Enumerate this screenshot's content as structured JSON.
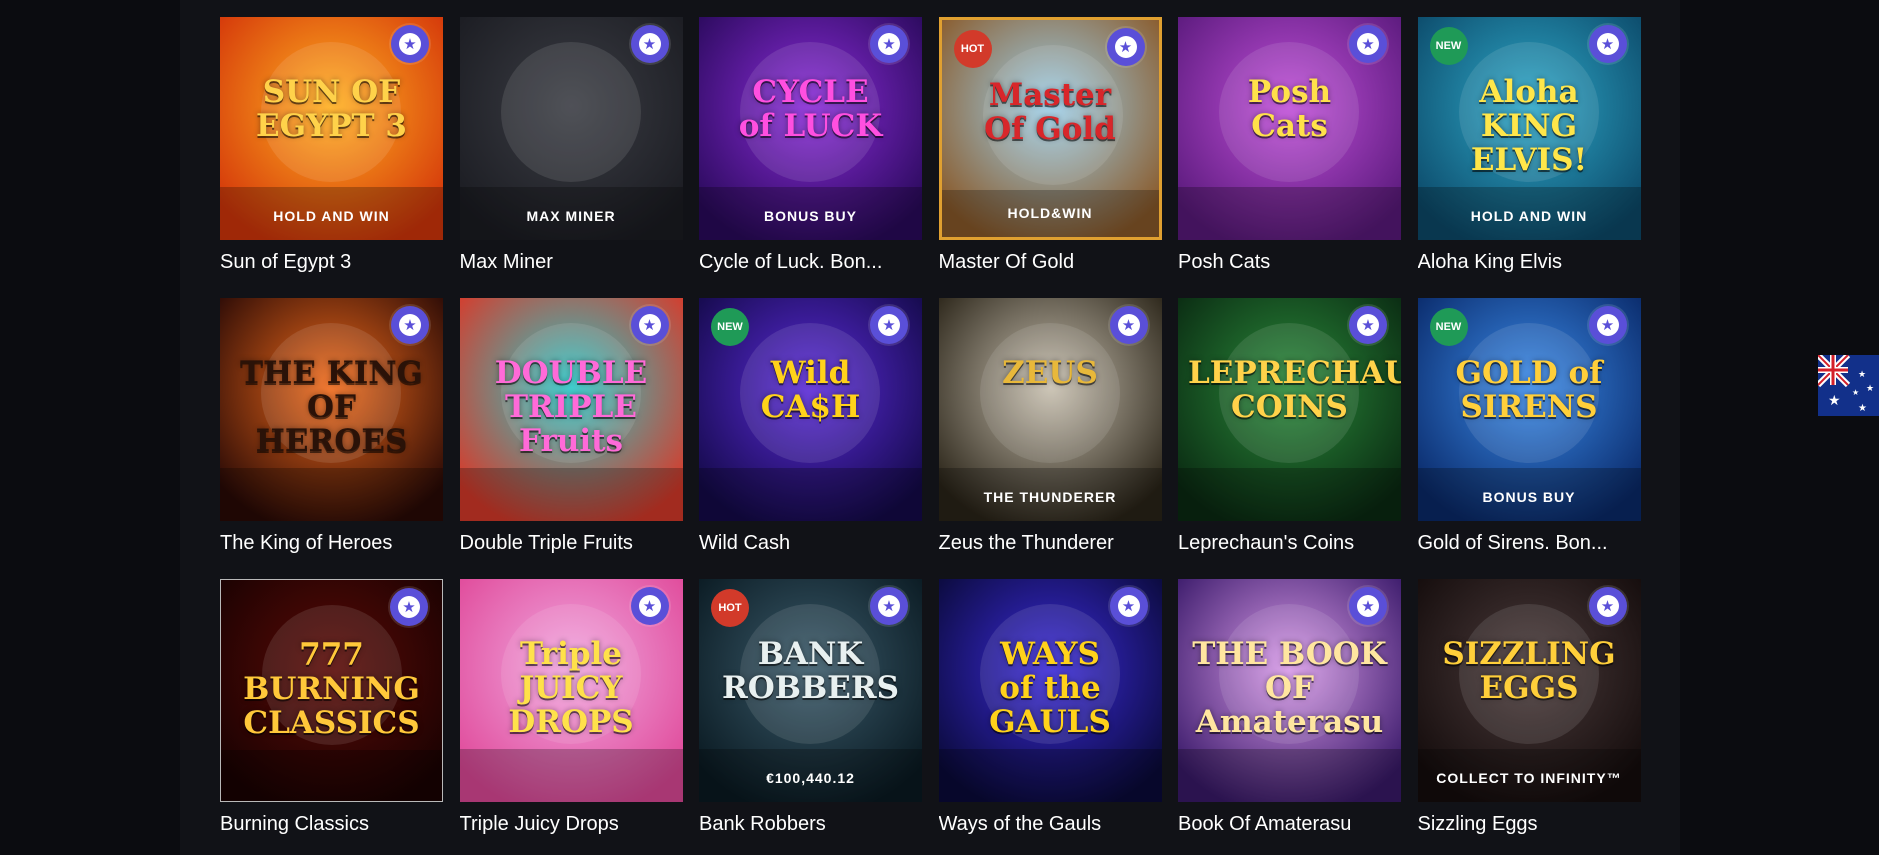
{
  "games": [
    {
      "name": "Sun of Egypt 3",
      "art_title": "SUN OF\nEGYPT 3",
      "art_sub": "HOLD AND WIN",
      "badge": "",
      "colors": [
        "#ffb020",
        "#d4360a"
      ],
      "title_color": "#ffd24a"
    },
    {
      "name": "Max Miner",
      "art_title": "",
      "art_sub": "MAX MINER",
      "badge": "",
      "colors": [
        "#3b3d44",
        "#1b1c22"
      ],
      "title_color": "#e9e3d3"
    },
    {
      "name": "Cycle of Luck. Bon...",
      "art_title": "CYCLE\nof LUCK",
      "art_sub": "BONUS BUY",
      "badge": "",
      "colors": [
        "#8a2bd8",
        "#2a0a5c"
      ],
      "title_color": "#ff4fe0"
    },
    {
      "name": "Master Of Gold",
      "art_title": "Master\nOf Gold",
      "art_sub": "HOLD&WIN",
      "badge": "HOT",
      "colors": [
        "#9ed0ea",
        "#8a5a2a"
      ],
      "title_color": "#d8262a"
    },
    {
      "name": "Posh Cats",
      "art_title": "Posh\nCats",
      "art_sub": "",
      "badge": "",
      "colors": [
        "#c04fd8",
        "#5a1a7c"
      ],
      "title_color": "#ffe14a"
    },
    {
      "name": "Aloha King Elvis",
      "art_title": "Aloha\nKING ELVIS!",
      "art_sub": "HOLD AND WIN",
      "badge": "NEW",
      "colors": [
        "#2ea8c8",
        "#0c4a6a"
      ],
      "title_color": "#ffe64a"
    },
    {
      "name": "The King of Heroes",
      "art_title": "THE KING OF\nHEROES",
      "art_sub": "",
      "badge": "",
      "colors": [
        "#f06a1a",
        "#2a0a06"
      ],
      "title_color": "#2a1208"
    },
    {
      "name": "Double Triple Fruits",
      "art_title": "DOUBLE TRIPLE\nFruits",
      "art_sub": "",
      "badge": "",
      "colors": [
        "#2ac8c8",
        "#d83a2a"
      ],
      "title_color": "#ff6ad8"
    },
    {
      "name": "Wild Cash",
      "art_title": "Wild\nCA$H",
      "art_sub": "",
      "badge": "NEW",
      "colors": [
        "#5a2ad8",
        "#140a4a"
      ],
      "title_color": "#ffd21a"
    },
    {
      "name": "Zeus the Thunderer",
      "art_title": "ZEUS",
      "art_sub": "THE THUNDERER",
      "badge": "",
      "colors": [
        "#c8c0b0",
        "#2a2418"
      ],
      "title_color": "#e8b83a"
    },
    {
      "name": "Leprechaun's Coins",
      "art_title": "LEPRECHAUN'S\nCOINS",
      "art_sub": "",
      "badge": "",
      "colors": [
        "#2a8a3a",
        "#0a2a12"
      ],
      "title_color": "#ffd24a"
    },
    {
      "name": "Gold of Sirens. Bon...",
      "art_title": "GOLD of\nSIRENS",
      "art_sub": "BONUS BUY",
      "badge": "NEW",
      "colors": [
        "#3a8ae8",
        "#0a2a6a"
      ],
      "title_color": "#ffcf3a"
    },
    {
      "name": "Burning Classics",
      "art_title": "777\nBURNING CLASSICS",
      "art_sub": "",
      "badge": "",
      "colors": [
        "#5a0a06",
        "#1a0202"
      ],
      "title_color": "#ffc83a"
    },
    {
      "name": "Triple Juicy Drops",
      "art_title": "Triple\nJUICY\nDROPS",
      "art_sub": "",
      "badge": "",
      "colors": [
        "#f0a8e0",
        "#e04a9a"
      ],
      "title_color": "#ffe14a"
    },
    {
      "name": "Bank Robbers",
      "art_title": "BANK ROBBERS",
      "art_sub": "€100,440.12",
      "badge": "HOT",
      "colors": [
        "#3a5a6a",
        "#0a1a22"
      ],
      "title_color": "#e8f0f0"
    },
    {
      "name": "Ways of the Gauls",
      "art_title": "WAYS\nof the\nGAULS",
      "art_sub": "",
      "badge": "",
      "colors": [
        "#3a2ad8",
        "#0a0a3a"
      ],
      "title_color": "#ffd21a"
    },
    {
      "name": "Book Of Amaterasu",
      "art_title": "THE BOOK OF\nAmaterasu",
      "art_sub": "",
      "badge": "",
      "colors": [
        "#d89ae8",
        "#3a1a6a"
      ],
      "title_color": "#ffe6a0"
    },
    {
      "name": "Sizzling Eggs",
      "art_title": "SIZZLING\nEGGS",
      "art_sub": "COLLECT TO INFINITY™",
      "badge": "",
      "colors": [
        "#4a3a3a",
        "#140c0c"
      ],
      "title_color": "#ffcf3a"
    }
  ],
  "ui": {
    "favorite_icon": "star-icon",
    "language_flag": "australia-flag-icon"
  }
}
